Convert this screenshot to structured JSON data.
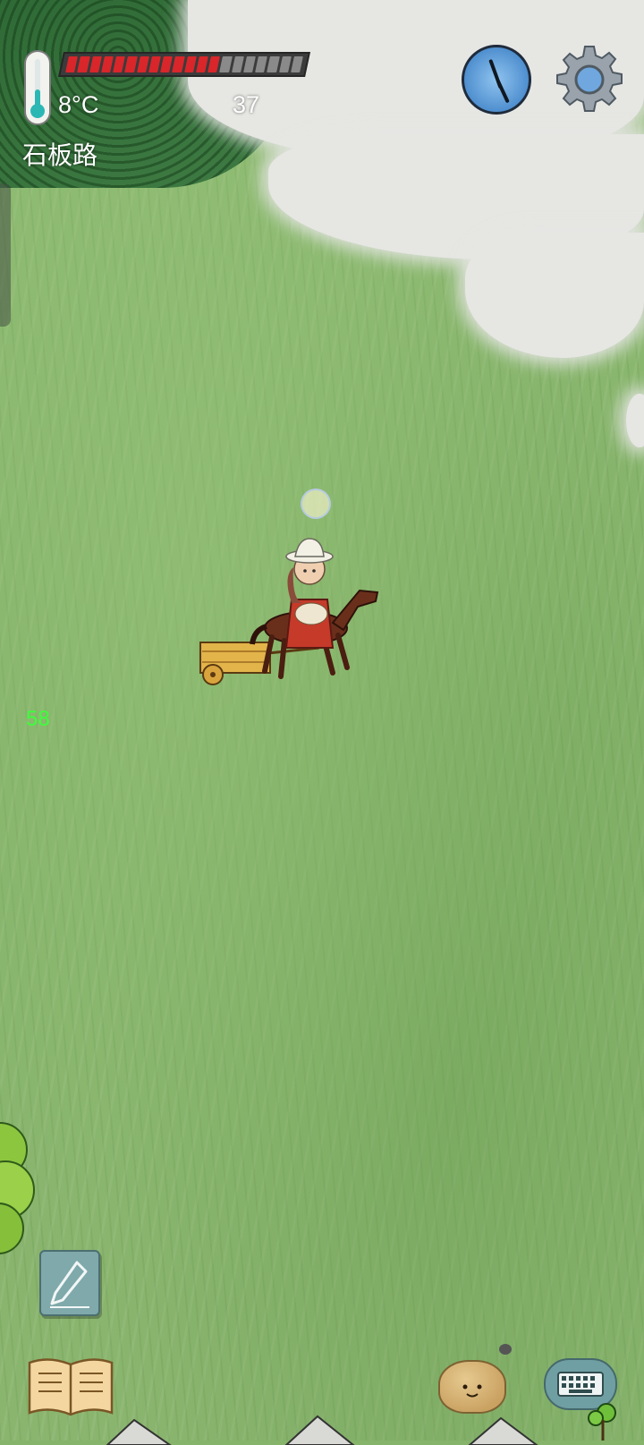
{
  "hud": {
    "temperature": "8°C",
    "location": "石板路",
    "food_pips_total": 20,
    "food_pips_full": 13,
    "age": "37",
    "fps": "58"
  },
  "icons": {
    "thermometer": "thermometer-icon",
    "compass": "compass-icon",
    "settings": "gear-icon",
    "pencil": "pencil-icon",
    "book": "book-icon",
    "emote": "emote-icon",
    "keyboard": "keyboard-icon"
  },
  "colors": {
    "food_full": "#d8262b",
    "food_empty": "#8a8a8a",
    "fps_text": "#3cff3c",
    "grass": "#86b46a"
  }
}
